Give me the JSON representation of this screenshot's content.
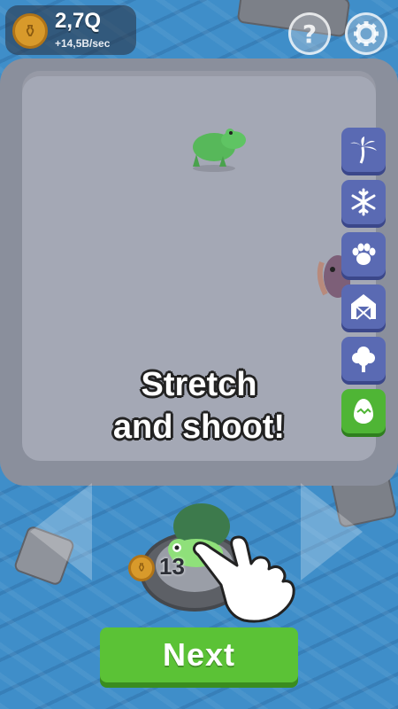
{
  "hud": {
    "money": "2,7Q",
    "rate": "+14,5B/sec",
    "coin_icon": "coin-icon",
    "help_label": "?",
    "settings_icon": "gear-icon"
  },
  "tabs": [
    {
      "icon": "palm-tree-icon",
      "active": false
    },
    {
      "icon": "snowflake-icon",
      "active": false
    },
    {
      "icon": "paw-icon",
      "active": false
    },
    {
      "icon": "barn-icon",
      "active": false
    },
    {
      "icon": "tree-icon",
      "active": false
    },
    {
      "icon": "egg-icon",
      "active": true
    }
  ],
  "caption": {
    "line1": "Stretch",
    "line2": "and shoot!"
  },
  "launcher": {
    "cost": "13"
  },
  "next_button": {
    "label": "Next"
  },
  "colors": {
    "accent_green": "#5bc236",
    "tab_blue": "#5a6ab3",
    "water": "#3f8ec9"
  }
}
